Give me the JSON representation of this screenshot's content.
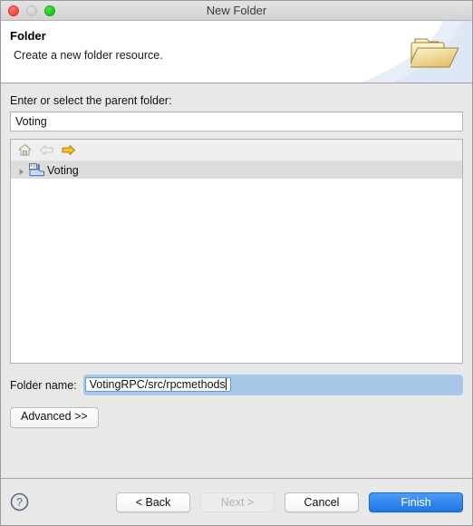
{
  "window": {
    "title": "New Folder",
    "traffic_lights": [
      "close-button",
      "minimize-button",
      "zoom-button"
    ]
  },
  "header": {
    "title": "Folder",
    "subtitle": "Create a new folder resource.",
    "icon": "open-folder-icon"
  },
  "parent_folder": {
    "label": "Enter or select the parent folder:",
    "value": "Voting",
    "placeholder": ""
  },
  "tree": {
    "toolbar": [
      {
        "name": "home-icon",
        "enabled": true
      },
      {
        "name": "back-arrow-icon",
        "enabled": false
      },
      {
        "name": "forward-arrow-icon",
        "enabled": true
      }
    ],
    "rows": [
      {
        "label": "Voting",
        "icon": "project-folder-icon",
        "expanded": false,
        "selected": true
      }
    ]
  },
  "folder_name": {
    "label": "Folder name:",
    "value": "VotingRPC/src/rpcmethods",
    "placeholder": "",
    "focused": true
  },
  "advanced": {
    "label": "Advanced >>"
  },
  "footer": {
    "help_icon": "help-question-icon",
    "buttons": [
      {
        "label": "< Back",
        "state": "normal",
        "name": "back-button"
      },
      {
        "label": "Next >",
        "state": "disabled",
        "name": "next-button"
      },
      {
        "label": "Cancel",
        "state": "normal",
        "name": "cancel-button"
      },
      {
        "label": "Finish",
        "state": "primary",
        "name": "finish-button"
      }
    ]
  },
  "colors": {
    "accent": "#1f74e8",
    "window_bg": "#e8e8e8",
    "header_bg": "#ffffff",
    "selection": "#dcdcdc",
    "focus_ring": "#5b9fdd",
    "folder_icon": "#e8cd7d"
  }
}
